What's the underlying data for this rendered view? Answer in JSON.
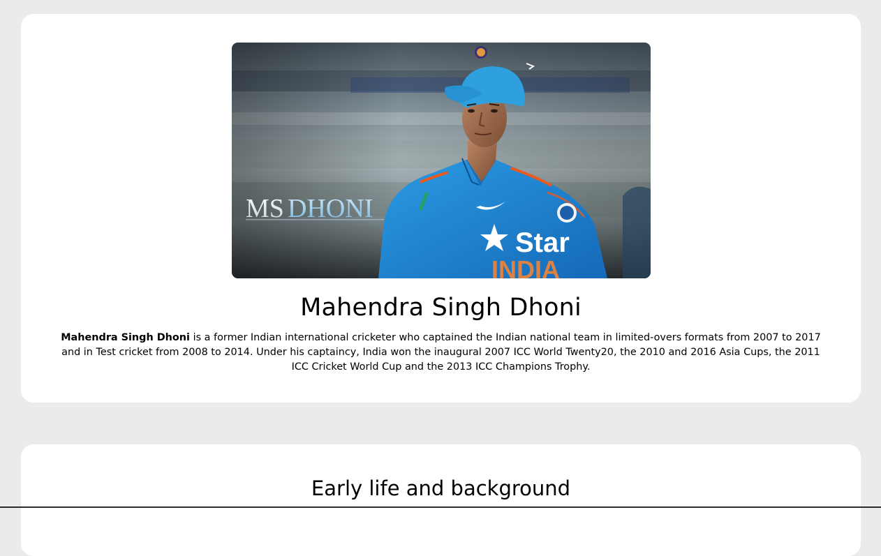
{
  "hero": {
    "image_overlay_text": {
      "part1": "MS",
      "part2": "DHONI"
    },
    "jersey_text": "Star",
    "jersey_subtext": "INDIA",
    "title": "Mahendra Singh Dhoni",
    "description_bold": "Mahendra Singh Dhoni",
    "description_rest": " is a former Indian international cricketer who captained the Indian national team in limited-overs formats from 2007 to 2017 and in Test cricket from 2008 to 2014. Under his captaincy, India won the inaugural 2007 ICC World Twenty20, the 2010 and 2016 Asia Cups, the 2011 ICC Cricket World Cup and the 2013 ICC Champions Trophy."
  },
  "early_life": {
    "title": "Early life and background"
  },
  "colors": {
    "page_background": "#ebebeb",
    "card_background": "#ffffff",
    "jersey_blue": "#1e88d6",
    "cap_blue": "#2a9ad8"
  }
}
